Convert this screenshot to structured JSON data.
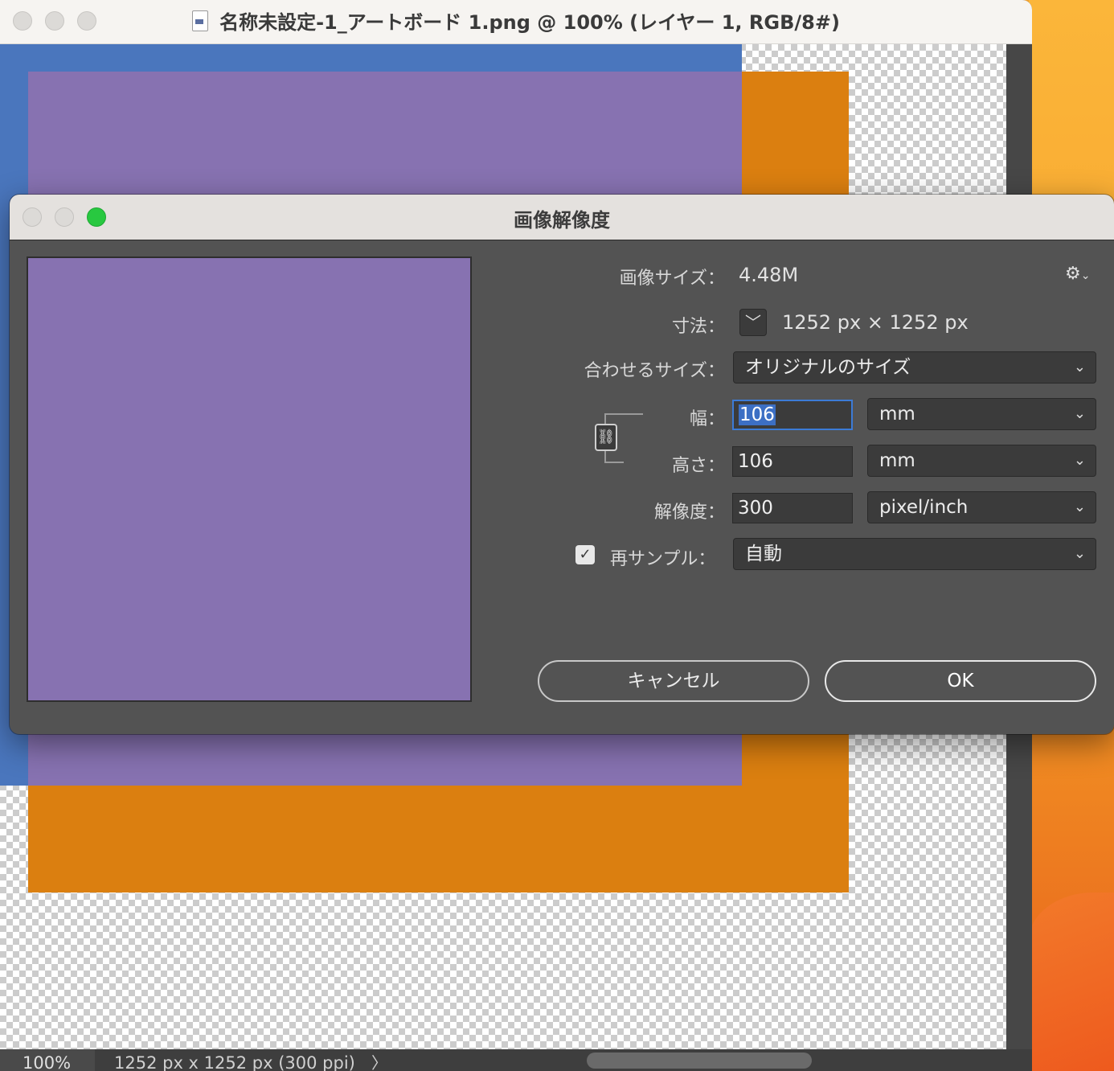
{
  "document": {
    "title": "名称未設定-1_アートボード 1.png @ 100% (レイヤー 1, RGB/8#)",
    "file_icon": "document-icon",
    "status": {
      "zoom": "100%",
      "info": "1252 px x 1252 px (300 ppi)",
      "arrow": "〉"
    }
  },
  "dialog": {
    "title": "画像解像度",
    "image_size_label": "画像サイズ：",
    "image_size_value": "4.48M",
    "settings_icon": "gear-icon",
    "settings_glyph": "⚙",
    "settings_caret": "⌄",
    "dimensions_label": "寸法：",
    "dimensions_toggle": "﹀",
    "dimensions_value": "1252 px × 1252 px",
    "fit_to_label": "合わせるサイズ：",
    "fit_to_value": "オリジナルのサイズ",
    "width_label": "幅：",
    "width_value": "106",
    "width_unit": "mm",
    "height_label": "高さ：",
    "height_value": "106",
    "height_unit": "mm",
    "resolution_label": "解像度：",
    "resolution_value": "300",
    "resolution_unit": "pixel/inch",
    "resample_label": "再サンプル：",
    "resample_checked": true,
    "resample_value": "自動",
    "cancel_label": "キャンセル",
    "ok_label": "OK",
    "chevron": "⌄",
    "check_glyph": "✓",
    "chain_glyph": "⛓"
  },
  "colors": {
    "blue_layer": "#4a76bd",
    "purple_layer": "#8772b1",
    "orange_layer": "#db7f10",
    "close_button": "#28c840"
  }
}
